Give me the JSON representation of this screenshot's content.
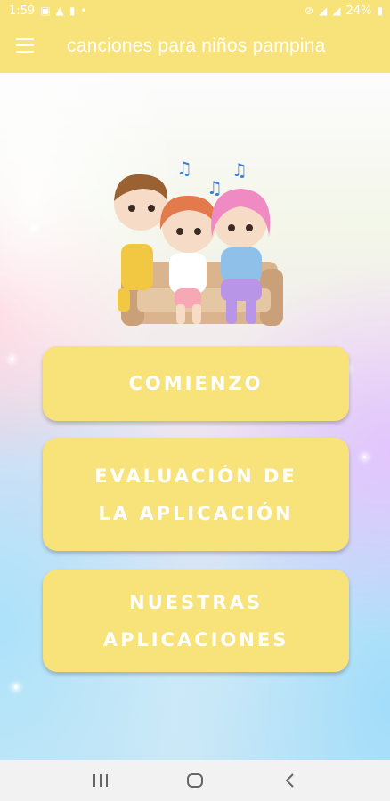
{
  "status_bar": {
    "time": "1:59",
    "battery": "24%"
  },
  "app_bar": {
    "title": "canciones para niños pampina",
    "menu_icon": "hamburger-menu-icon"
  },
  "buttons": {
    "start": "COMIENZO",
    "rate": "EVALUACIÓN DE\nLA APLICACIÓN",
    "apps": "NUESTRAS\nAPLICACIONES"
  },
  "nav_bar": {
    "recents_icon": "recents-icon",
    "home_icon": "home-icon",
    "back_icon": "back-icon"
  },
  "colors": {
    "accent": "#f8e27a",
    "text_on_accent": "#ffffff"
  }
}
